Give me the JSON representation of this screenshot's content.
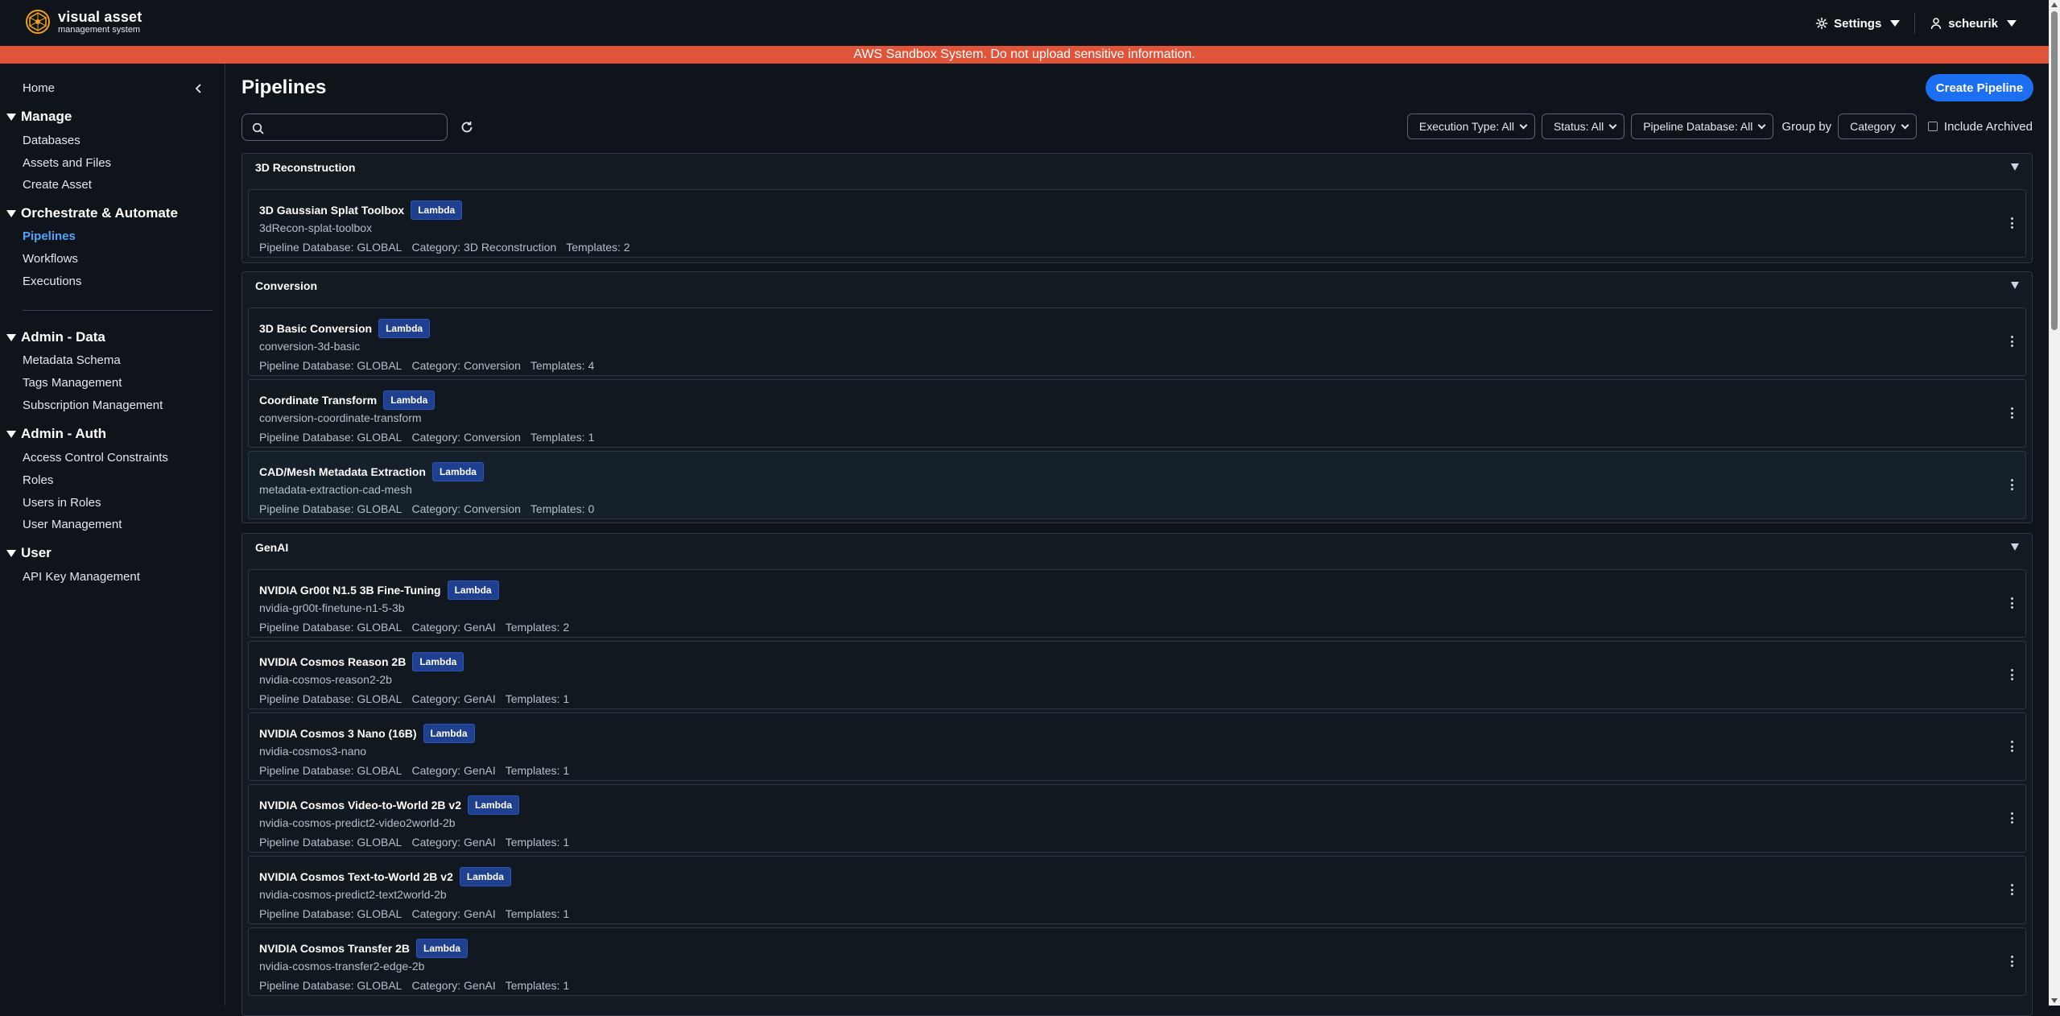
{
  "header": {
    "logo_title": "visual asset",
    "logo_subtitle": "management system",
    "settings_label": "Settings",
    "user_label": "scheurik"
  },
  "banner": {
    "text": "AWS Sandbox System. Do not upload sensitive information.",
    "color": "#e0553a"
  },
  "sidebar": {
    "home": "Home",
    "sections": [
      {
        "title": "Manage",
        "items": [
          "Databases",
          "Assets and Files",
          "Create Asset"
        ]
      },
      {
        "title": "Orchestrate & Automate",
        "items": [
          "Pipelines",
          "Workflows",
          "Executions"
        ]
      },
      {
        "title": "Admin - Data",
        "items": [
          "Metadata Schema",
          "Tags Management",
          "Subscription Management"
        ]
      },
      {
        "title": "Admin - Auth",
        "items": [
          "Access Control Constraints",
          "Roles",
          "Users in Roles",
          "User Management"
        ]
      },
      {
        "title": "User",
        "items": [
          "API Key Management"
        ]
      }
    ],
    "active_item": "Pipelines"
  },
  "main": {
    "title": "Pipelines",
    "create_button": "Create Pipeline",
    "search_value": "",
    "filters": {
      "execution_type": "Execution Type: All",
      "status": "Status: All",
      "pipeline_database": "Pipeline Database: All",
      "group_by_label": "Group by",
      "group_by_value": "Category",
      "include_archived": "Include Archived"
    },
    "groups": [
      {
        "name": "3D Reconstruction",
        "pipelines": [
          {
            "name": "3D Gaussian Splat Toolbox",
            "badge": "Lambda",
            "id": "3dRecon-splat-toolbox",
            "db": "Pipeline Database: GLOBAL",
            "category": "Category: 3D Reconstruction",
            "templates": "Templates: 2"
          }
        ]
      },
      {
        "name": "Conversion",
        "pipelines": [
          {
            "name": "3D Basic Conversion",
            "badge": "Lambda",
            "id": "conversion-3d-basic",
            "db": "Pipeline Database: GLOBAL",
            "category": "Category: Conversion",
            "templates": "Templates: 4"
          },
          {
            "name": "Coordinate Transform",
            "badge": "Lambda",
            "id": "conversion-coordinate-transform",
            "db": "Pipeline Database: GLOBAL",
            "category": "Category: Conversion",
            "templates": "Templates: 1"
          },
          {
            "name": "CAD/Mesh Metadata Extraction",
            "badge": "Lambda",
            "id": "metadata-extraction-cad-mesh",
            "db": "Pipeline Database: GLOBAL",
            "category": "Category: Conversion",
            "templates": "Templates: 0"
          }
        ]
      },
      {
        "name": "GenAI",
        "pipelines": [
          {
            "name": "NVIDIA Gr00t N1.5 3B Fine-Tuning",
            "badge": "Lambda",
            "id": "nvidia-gr00t-finetune-n1-5-3b",
            "db": "Pipeline Database: GLOBAL",
            "category": "Category: GenAI",
            "templates": "Templates: 2"
          },
          {
            "name": "NVIDIA Cosmos Reason 2B",
            "badge": "Lambda",
            "id": "nvidia-cosmos-reason2-2b",
            "db": "Pipeline Database: GLOBAL",
            "category": "Category: GenAI",
            "templates": "Templates: 1"
          },
          {
            "name": "NVIDIA Cosmos 3 Nano (16B)",
            "badge": "Lambda",
            "id": "nvidia-cosmos3-nano",
            "db": "Pipeline Database: GLOBAL",
            "category": "Category: GenAI",
            "templates": "Templates: 1"
          },
          {
            "name": "NVIDIA Cosmos Video-to-World 2B v2",
            "badge": "Lambda",
            "id": "nvidia-cosmos-predict2-video2world-2b",
            "db": "Pipeline Database: GLOBAL",
            "category": "Category: GenAI",
            "templates": "Templates: 1"
          },
          {
            "name": "NVIDIA Cosmos Text-to-World 2B v2",
            "badge": "Lambda",
            "id": "nvidia-cosmos-predict2-text2world-2b",
            "db": "Pipeline Database: GLOBAL",
            "category": "Category: GenAI",
            "templates": "Templates: 1"
          },
          {
            "name": "NVIDIA Cosmos Transfer 2B",
            "badge": "Lambda",
            "id": "nvidia-cosmos-transfer2-edge-2b",
            "db": "Pipeline Database: GLOBAL",
            "category": "Category: GenAI",
            "templates": "Templates: 1"
          }
        ]
      }
    ]
  },
  "colors": {
    "accent": "#1d6ff2",
    "active_link": "#4da3ff",
    "badge": "#1f3f8f",
    "background": "#0f141b"
  }
}
